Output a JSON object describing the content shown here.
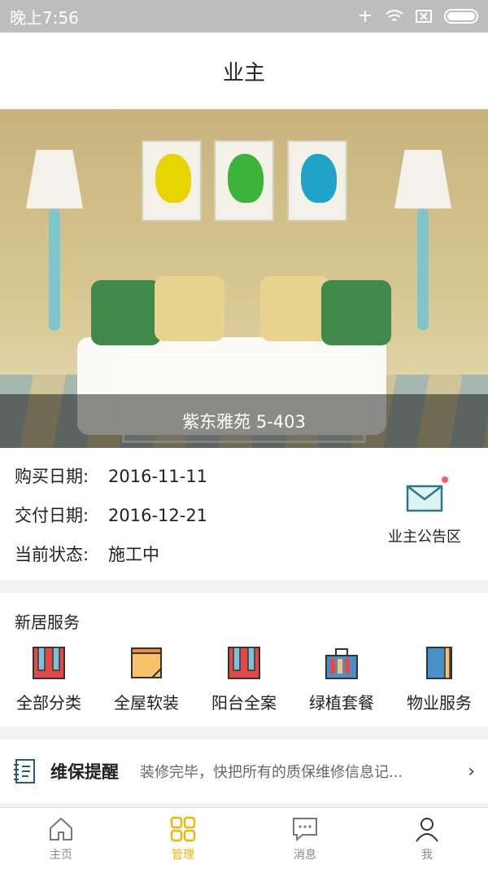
{
  "status": {
    "time": "晚上7:56"
  },
  "header": {
    "title": "业主"
  },
  "hero": {
    "caption": "紫东雅苑 5-403"
  },
  "info": {
    "rows": [
      {
        "label": "购买日期:",
        "value": "2016-11-11"
      },
      {
        "label": "交付日期:",
        "value": "2016-12-21"
      },
      {
        "label": "当前状态:",
        "value": "施工中"
      }
    ],
    "notice_label": "业主公告区"
  },
  "services": {
    "title": "新居服务",
    "items": [
      {
        "label": "全部分类",
        "icon": "category-icon"
      },
      {
        "label": "全屋软装",
        "icon": "note-icon"
      },
      {
        "label": "阳台全案",
        "icon": "balcony-icon"
      },
      {
        "label": "绿植套餐",
        "icon": "plant-icon"
      },
      {
        "label": "物业服务",
        "icon": "book-icon"
      }
    ]
  },
  "reminder": {
    "title": "维保提醒",
    "desc": "装修完毕，快把所有的质保维修信息记..."
  },
  "tabs": [
    {
      "label": "主页",
      "icon": "home-icon"
    },
    {
      "label": "管理",
      "icon": "grid-icon"
    },
    {
      "label": "消息",
      "icon": "message-icon"
    },
    {
      "label": "我",
      "icon": "user-icon"
    }
  ],
  "colors": {
    "accent": "#f2b600",
    "icon_red": "#e24a4a",
    "icon_blue": "#4a90c8"
  }
}
